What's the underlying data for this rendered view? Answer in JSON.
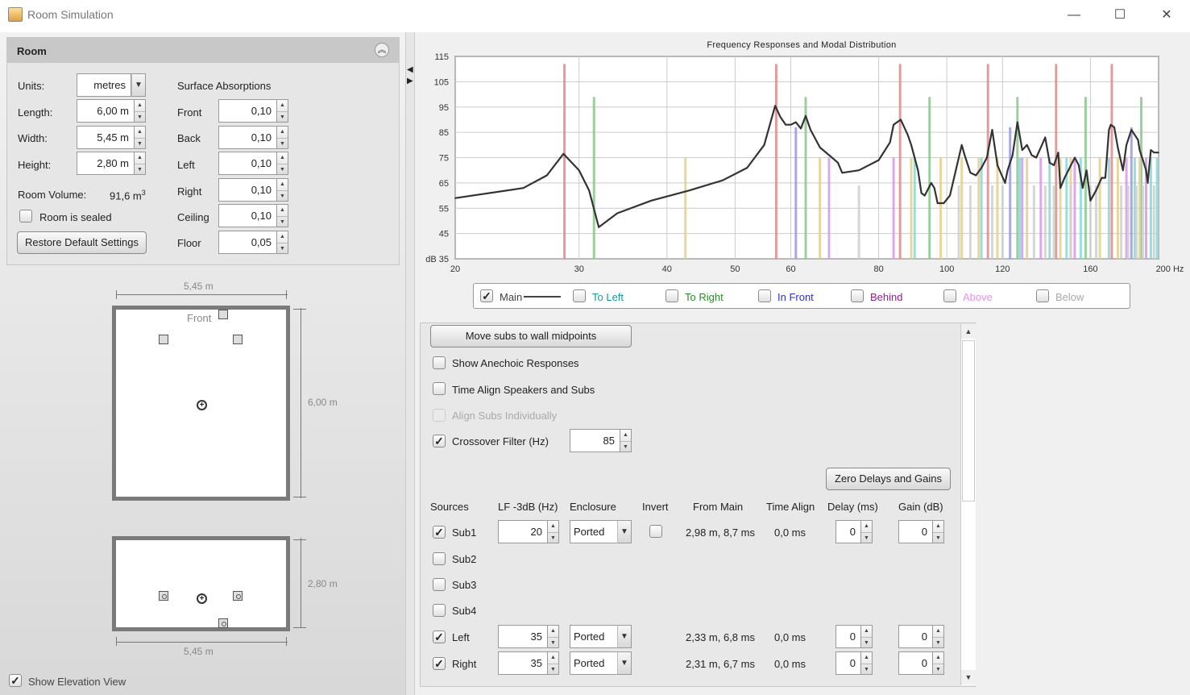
{
  "window": {
    "title": "Room Simulation",
    "minimize": "—",
    "maximize": "☐",
    "close": "✕"
  },
  "room": {
    "title": "Room",
    "collapse_icon": "«",
    "units_label": "Units:",
    "units_value": "metres",
    "length_label": "Length:",
    "length_value": "6,00 m",
    "width_label": "Width:",
    "width_value": "5,45 m",
    "height_label": "Height:",
    "height_value": "2,80 m",
    "volume_label": "Room Volume:",
    "volume_value": "91,6 m",
    "volume_sup": "3",
    "sealed_label": "Room is sealed",
    "sealed_checked": false,
    "restore_label": "Restore Default Settings",
    "absorptions_title": "Surface Absorptions",
    "absorptions": [
      {
        "label": "Front",
        "value": "0,10"
      },
      {
        "label": "Back",
        "value": "0,10"
      },
      {
        "label": "Left",
        "value": "0,10"
      },
      {
        "label": "Right",
        "value": "0,10"
      },
      {
        "label": "Ceiling",
        "value": "0,10"
      },
      {
        "label": "Floor",
        "value": "0,05"
      }
    ]
  },
  "plan": {
    "width_dim": "5,45 m",
    "length_dim": "6,00 m",
    "front_label": "Front",
    "height_dim": "2,80 m",
    "elev_width_dim": "5,45 m"
  },
  "show_elevation": {
    "label": "Show Elevation View",
    "checked": true
  },
  "chart_data": {
    "type": "line",
    "title": "Frequency Responses and Modal Distribution",
    "xscale": "log",
    "xlim": [
      20,
      200
    ],
    "ylim": [
      35,
      115
    ],
    "grid": true,
    "xticks": [
      "20",
      "30",
      "40",
      "50",
      "60",
      "80",
      "100",
      "120",
      "160",
      "200 Hz"
    ],
    "xtick_values": [
      20,
      30,
      40,
      50,
      60,
      80,
      100,
      120,
      160,
      200
    ],
    "yticks": [
      "dB 35",
      "45",
      "55",
      "65",
      "75",
      "85",
      "95",
      "105",
      "115"
    ],
    "ytick_values": [
      35,
      45,
      55,
      65,
      75,
      85,
      95,
      105,
      115
    ],
    "series": [
      {
        "name": "Main",
        "color": "#333333",
        "x": [
          20,
          25,
          27,
          28.5,
          30,
          31,
          32,
          34,
          38,
          43,
          48,
          52,
          55,
          57,
          58,
          59,
          60,
          61,
          62,
          63,
          64,
          66,
          68,
          70,
          71,
          75,
          80,
          83,
          84,
          86,
          88,
          89,
          91,
          92,
          93,
          95,
          96,
          97,
          99,
          101,
          105,
          106,
          108,
          110,
          112,
          114,
          116,
          118,
          121,
          122,
          124,
          126,
          128,
          130,
          132,
          134,
          136,
          138,
          140,
          142,
          144,
          145,
          147,
          152,
          154,
          156,
          158,
          160,
          163,
          166,
          168,
          170,
          171,
          173,
          175,
          178,
          180,
          183,
          185,
          187,
          188,
          190,
          192,
          193,
          195,
          197,
          200
        ],
        "y": [
          59,
          63,
          68,
          76.5,
          70,
          62,
          47.5,
          53,
          58,
          62,
          66,
          71,
          80,
          95.5,
          91,
          88,
          88,
          89,
          86.5,
          91.5,
          86,
          79,
          76,
          73,
          69,
          70,
          74,
          81,
          88,
          90,
          84,
          80,
          70,
          61,
          60,
          65,
          63,
          57,
          57,
          60,
          80,
          76,
          69,
          68,
          71,
          75,
          86,
          72,
          65,
          70,
          76,
          89,
          78,
          80,
          76,
          75,
          79,
          83,
          73,
          72,
          77,
          63,
          67,
          75,
          72,
          63,
          70,
          58,
          62,
          67,
          67,
          86,
          88,
          87,
          79,
          70,
          80,
          86,
          84,
          82,
          78,
          74,
          70,
          65,
          78,
          77,
          77
        ]
      }
    ],
    "modes": {
      "red": {
        "color": "#e08a8a",
        "level": 112,
        "f": [
          28.6,
          57.2,
          85.8,
          114.4,
          143,
          171.6
        ]
      },
      "green": {
        "color": "#8cc68c",
        "level": 99,
        "f": [
          31.5,
          63,
          94.5,
          126,
          157.5,
          189
        ]
      },
      "blue": {
        "color": "#9a9ae6",
        "level": 87,
        "f": [
          61,
          123,
          183
        ]
      },
      "yellow": {
        "color": "#e6d08c",
        "level": 75,
        "f": [
          42.5,
          66,
          89,
          98,
          105,
          111,
          118,
          130,
          145,
          150,
          165,
          175,
          188
        ]
      },
      "magenta": {
        "color": "#d89ae6",
        "level": 75,
        "f": [
          68,
          84,
          128,
          136,
          152,
          180,
          192
        ]
      },
      "cyan": {
        "color": "#8ad8d8",
        "level": 75,
        "f": [
          90,
          112,
          127,
          140,
          148,
          155,
          170,
          185,
          195,
          199
        ]
      },
      "grey": {
        "color": "#cfcfcf",
        "level": 64,
        "f": [
          75,
          104,
          108,
          116,
          120,
          133,
          138,
          142,
          150,
          160,
          163,
          177,
          181,
          186,
          190,
          197
        ]
      }
    },
    "legend": [
      {
        "label": "Main",
        "checked": true,
        "color": "#444444"
      },
      {
        "label": "To Left",
        "checked": false,
        "color": "#1a9a9a"
      },
      {
        "label": "To Right",
        "checked": false,
        "color": "#2a8a2a"
      },
      {
        "label": "In Front",
        "checked": false,
        "color": "#3030c0"
      },
      {
        "label": "Behind",
        "checked": false,
        "color": "#902090"
      },
      {
        "label": "Above",
        "checked": false,
        "color": "#e890e8"
      },
      {
        "label": "Below",
        "checked": false,
        "color": "#a8a8a8"
      }
    ]
  },
  "controls": {
    "move_subs": "Move subs to wall midpoints",
    "anechoic": {
      "label": "Show Anechoic Responses",
      "checked": false
    },
    "time_align": {
      "label": "Time Align Speakers and Subs",
      "checked": false
    },
    "align_subs": {
      "label": "Align Subs Individually",
      "checked": false
    },
    "crossover": {
      "label": "Crossover Filter (Hz)",
      "checked": true,
      "value": "85"
    },
    "zero_delays": "Zero Delays and Gains"
  },
  "sources": {
    "headers": [
      "Sources",
      "LF -3dB (Hz)",
      "Enclosure",
      "Invert",
      "From Main",
      "Time Align",
      "Delay (ms)",
      "Gain (dB)"
    ],
    "rows": [
      {
        "name": "Sub1",
        "checked": true,
        "lf": "20",
        "enclosure": "Ported",
        "invert": false,
        "from_main": "2,98 m, 8,7 ms",
        "time_align": "0,0 ms",
        "delay": "0",
        "gain": "0"
      },
      {
        "name": "Sub2",
        "checked": false
      },
      {
        "name": "Sub3",
        "checked": false
      },
      {
        "name": "Sub4",
        "checked": false
      },
      {
        "name": "Left",
        "checked": true,
        "lf": "35",
        "enclosure": "Ported",
        "from_main": "2,33 m, 6,8 ms",
        "time_align": "0,0 ms",
        "delay": "0",
        "gain": "0"
      },
      {
        "name": "Right",
        "checked": true,
        "lf": "35",
        "enclosure": "Ported",
        "from_main": "2,31 m, 6,7 ms",
        "time_align": "0,0 ms",
        "delay": "0",
        "gain": "0"
      }
    ]
  }
}
